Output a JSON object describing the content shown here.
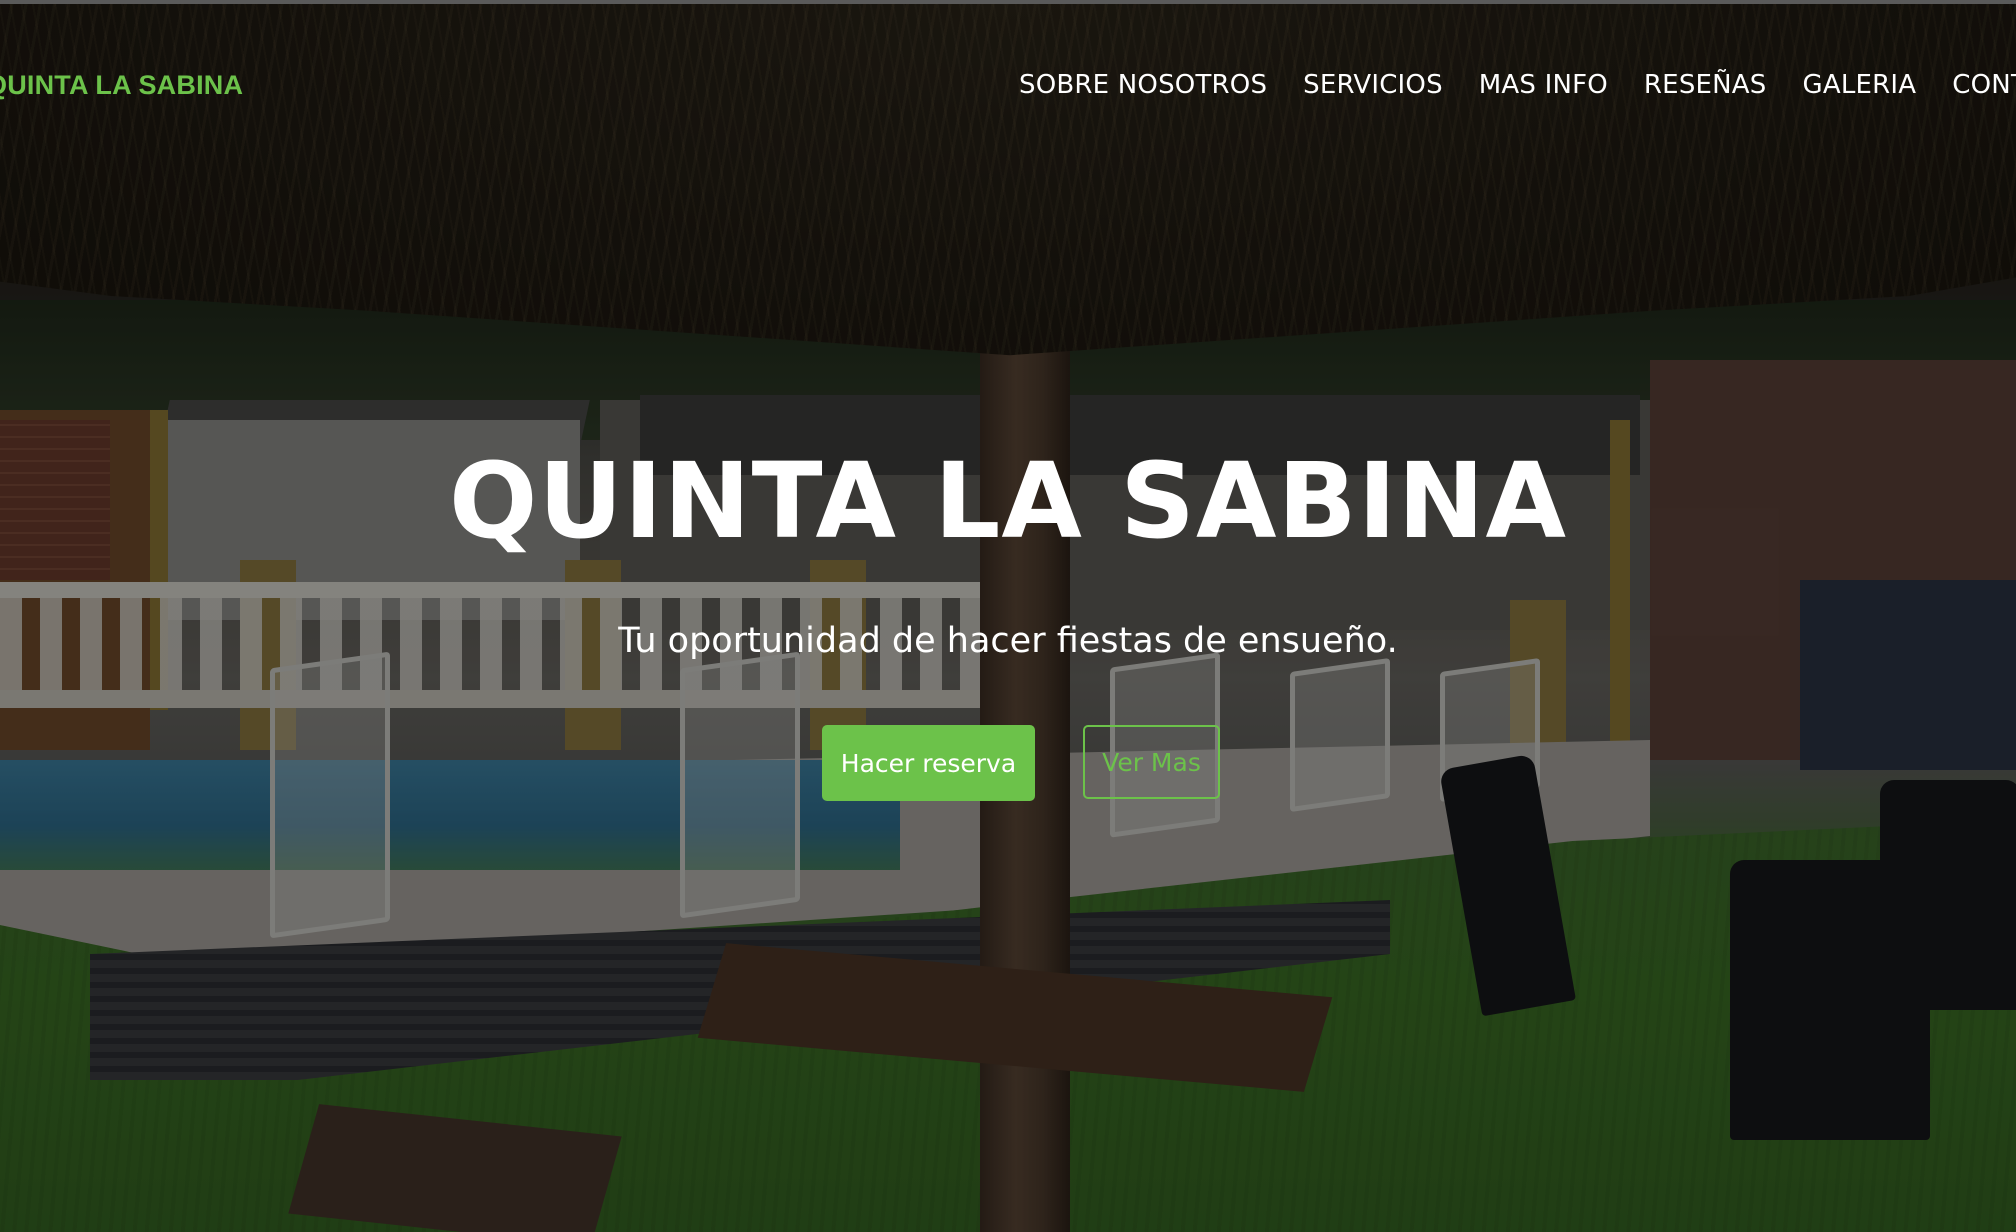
{
  "nav": {
    "brand": "QUINTA LA SABINA",
    "items": [
      {
        "label": "SOBRE NOSOTROS"
      },
      {
        "label": "SERVICIOS"
      },
      {
        "label": "MAS INFO"
      },
      {
        "label": "RESEÑAS"
      },
      {
        "label": "GALERIA"
      },
      {
        "label": "CONTACTO"
      }
    ]
  },
  "hero": {
    "title": "QUINTA LA SABINA",
    "subtitle": "Tu oportunidad de hacer fiestas de ensueño.",
    "primary_button": "Hacer reserva",
    "secondary_button": "Ver Mas",
    "background_image": "pool-and-garden-photo"
  },
  "colors": {
    "accent": "#6cc24a",
    "text": "#ffffff"
  }
}
